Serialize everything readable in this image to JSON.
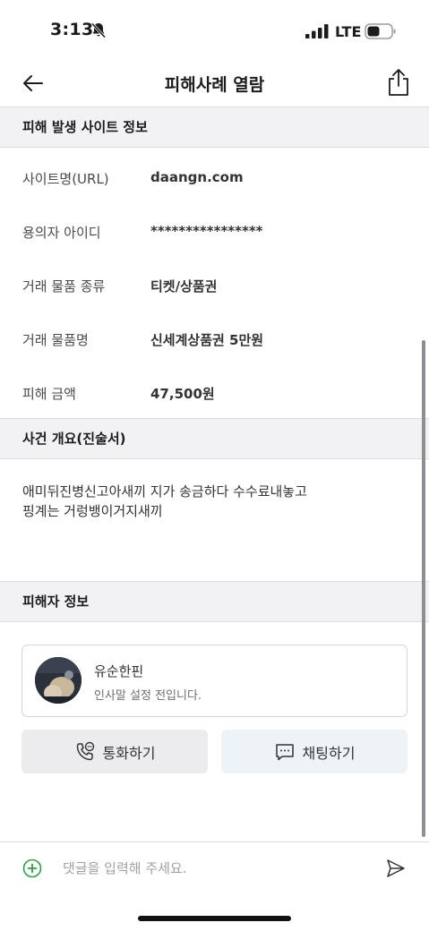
{
  "status_bar": {
    "time": "3:13",
    "network": "LTE",
    "icons": [
      "bell-slash-icon",
      "signal-icon",
      "battery-icon"
    ]
  },
  "nav": {
    "title": "피해사례 열람",
    "icons": [
      "back-arrow-icon",
      "share-icon"
    ]
  },
  "site_section": {
    "header": "피해 발생 사이트 정보",
    "rows": [
      {
        "label": "사이트명(URL)",
        "value": "daangn.com"
      },
      {
        "label": "용의자 아이디",
        "value": "****************"
      },
      {
        "label": "거래 물품 종류",
        "value": "티켓/상품권"
      },
      {
        "label": "거래 물품명",
        "value": "신세계상품권 5만원"
      },
      {
        "label": "피해 금액",
        "value": "47,500원"
      }
    ]
  },
  "summary_section": {
    "header": "사건 개요(진술서)",
    "line1": "애미뒤진병신고아새끼 지가 송금하다 수수료내놓고",
    "line2": "핑계는 거렁뱅이거지새끼"
  },
  "victim_section": {
    "header": "피해자 정보",
    "name": "유순한핀",
    "greeting": "인사말 설정 전입니다.",
    "call_label": "통화하기",
    "chat_label": "채팅하기"
  },
  "comment_bar": {
    "placeholder": "댓글을 입력해 주세요.",
    "value": ""
  },
  "colors": {
    "section_bg": "#f2f2f4",
    "border": "#dcdce0",
    "add_icon": "#2e9e4a",
    "call_btn_bg": "#ececee",
    "chat_btn_bg": "#eef3f8"
  }
}
